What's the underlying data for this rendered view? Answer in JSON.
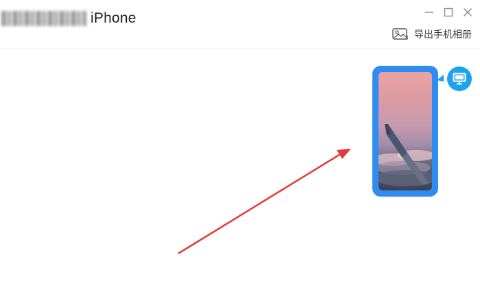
{
  "window": {
    "device_model": "iPhone"
  },
  "toolbar": {
    "export_label": "导出手机相册",
    "export_icon": "image-icon"
  },
  "controls": {
    "minimize_icon": "minimize-icon",
    "maximize_icon": "maximize-icon",
    "close_icon": "close-icon"
  },
  "phone_preview": {
    "badge_icon": "monitor-icon"
  },
  "colors": {
    "phone_frame": "#2f8cf3",
    "badge": "#1da1f2",
    "arrow": "#e53935"
  }
}
